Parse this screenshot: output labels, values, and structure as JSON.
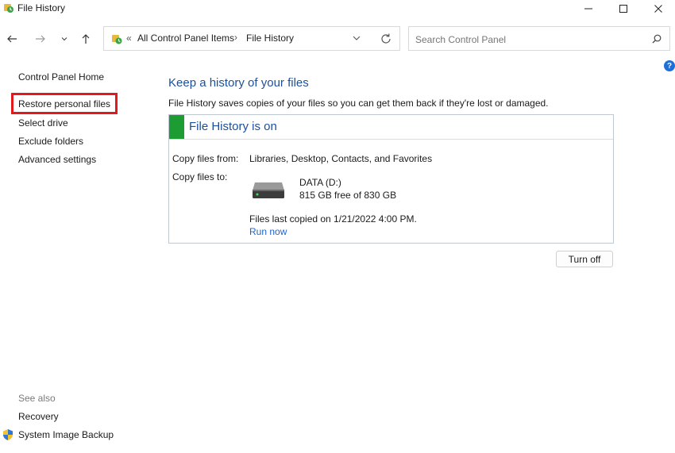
{
  "window": {
    "title": "File History",
    "icon": "file-history-icon"
  },
  "nav": {
    "back_icon": "arrow-left-icon",
    "forward_icon": "arrow-right-icon",
    "recent_icon": "chevron-down-icon",
    "up_icon": "arrow-up-icon"
  },
  "address": {
    "overflow_chevron": "«",
    "crumbs": [
      "All Control Panel Items",
      "File History"
    ],
    "separator": "›"
  },
  "search": {
    "placeholder": "Search Control Panel",
    "value": ""
  },
  "help": {
    "label": "?"
  },
  "sidebar": {
    "items": [
      "Control Panel Home",
      "Restore personal files",
      "Select drive",
      "Exclude folders",
      "Advanced settings"
    ],
    "see_also": "See also",
    "see_also_items": [
      "Recovery",
      "System Image Backup"
    ]
  },
  "main": {
    "heading": "Keep a history of your files",
    "description": "File History saves copies of your files so you can get them back if they're lost or damaged.",
    "status": {
      "title": "File History is on",
      "color": "#1c9c33",
      "copy_from_label": "Copy files from:",
      "copy_from_value": "Libraries, Desktop, Contacts, and Favorites",
      "copy_to_label": "Copy files to:",
      "drive_name": "DATA (D:)",
      "drive_free": "815 GB free of 830 GB",
      "last_copied": "Files last copied on 1/21/2022 4:00 PM.",
      "run_now": "Run now"
    },
    "turn_off": "Turn off"
  }
}
